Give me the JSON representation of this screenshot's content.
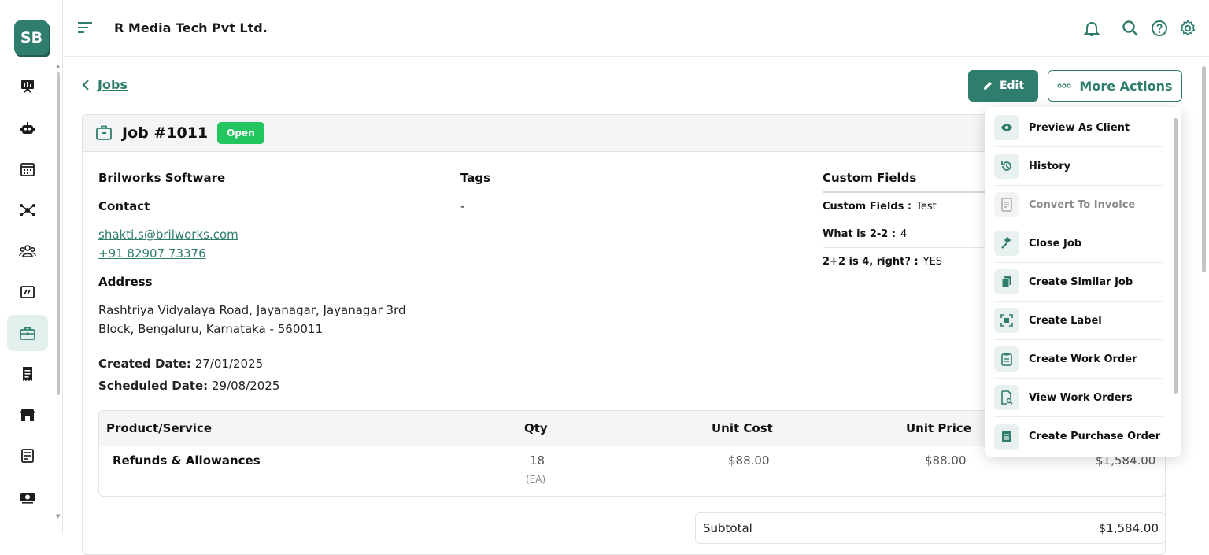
{
  "sidebar": {
    "logo": "SB",
    "items": [
      {
        "icon": "presentation-chart-icon",
        "name": "dashboard"
      },
      {
        "icon": "robot-icon",
        "name": "ai"
      },
      {
        "icon": "calendar-icon",
        "name": "calendar"
      },
      {
        "icon": "network-icon",
        "name": "network"
      },
      {
        "icon": "users-icon",
        "name": "clients"
      },
      {
        "icon": "chart-box-icon",
        "name": "reports"
      },
      {
        "icon": "briefcase-icon",
        "name": "jobs",
        "active": true
      },
      {
        "icon": "receipt-icon",
        "name": "invoices"
      },
      {
        "icon": "store-icon",
        "name": "store"
      },
      {
        "icon": "document-list-icon",
        "name": "documents"
      },
      {
        "icon": "money-icon",
        "name": "payments"
      }
    ]
  },
  "header": {
    "company": "R Media Tech Pvt Ltd.",
    "icons": [
      "bell-icon",
      "search-icon",
      "help-icon",
      "gear-icon"
    ]
  },
  "toolbar": {
    "back_label": "Jobs",
    "edit_label": "Edit",
    "more_label": "More Actions"
  },
  "job": {
    "title": "Job #1011",
    "status": "Open",
    "client": "Brilworks Software",
    "contact_heading": "Contact",
    "email": "shakti.s@brilworks.com",
    "phone": "+91 82907 73376",
    "address_heading": "Address",
    "address_line1": "Rashtriya Vidyalaya Road, Jayanagar, Jayanagar 3rd",
    "address_line2": "Block, Bengaluru, Karnataka - 560011",
    "created_label": "Created Date:",
    "created_value": "27/01/2025",
    "scheduled_label": "Scheduled Date:",
    "scheduled_value": "29/08/2025",
    "tags_heading": "Tags",
    "tags_value": "-",
    "custom_fields_heading": "Custom Fields",
    "custom_fields": [
      {
        "label": "Custom Fields :",
        "value": "Test"
      },
      {
        "label": "What is 2-2 :",
        "value": "4"
      },
      {
        "label": "2+2 is 4, right? :",
        "value": "YES"
      }
    ]
  },
  "table": {
    "headers": [
      "Product/Service",
      "Qty",
      "Unit Cost",
      "Unit Price"
    ],
    "rows": [
      {
        "product": "Refunds & Allowances",
        "qty": "18",
        "unit": "(EA)",
        "unit_cost": "$88.00",
        "unit_price": "$88.00",
        "total": "$1,584.00"
      }
    ]
  },
  "totals": {
    "subtotal_label": "Subtotal",
    "subtotal_value": "$1,584.00"
  },
  "more_actions_menu": [
    {
      "label": "Preview As Client",
      "icon": "eye-icon",
      "enabled": true
    },
    {
      "label": "History",
      "icon": "history-icon",
      "enabled": true
    },
    {
      "label": "Convert To Invoice",
      "icon": "invoice-icon",
      "enabled": false
    },
    {
      "label": "Close Job",
      "icon": "gavel-icon",
      "enabled": true
    },
    {
      "label": "Create Similar Job",
      "icon": "copy-icon",
      "enabled": true
    },
    {
      "label": "Create Label",
      "icon": "scan-icon",
      "enabled": true
    },
    {
      "label": "Create Work Order",
      "icon": "clipboard-icon",
      "enabled": true
    },
    {
      "label": "View Work Orders",
      "icon": "document-search-icon",
      "enabled": true
    },
    {
      "label": "Create Purchase Order",
      "icon": "purchase-order-icon",
      "enabled": true
    }
  ],
  "colors": {
    "brand": "#2f7d6d",
    "status_open": "#22c55e",
    "active_nav_bg": "#e3f0ed"
  }
}
